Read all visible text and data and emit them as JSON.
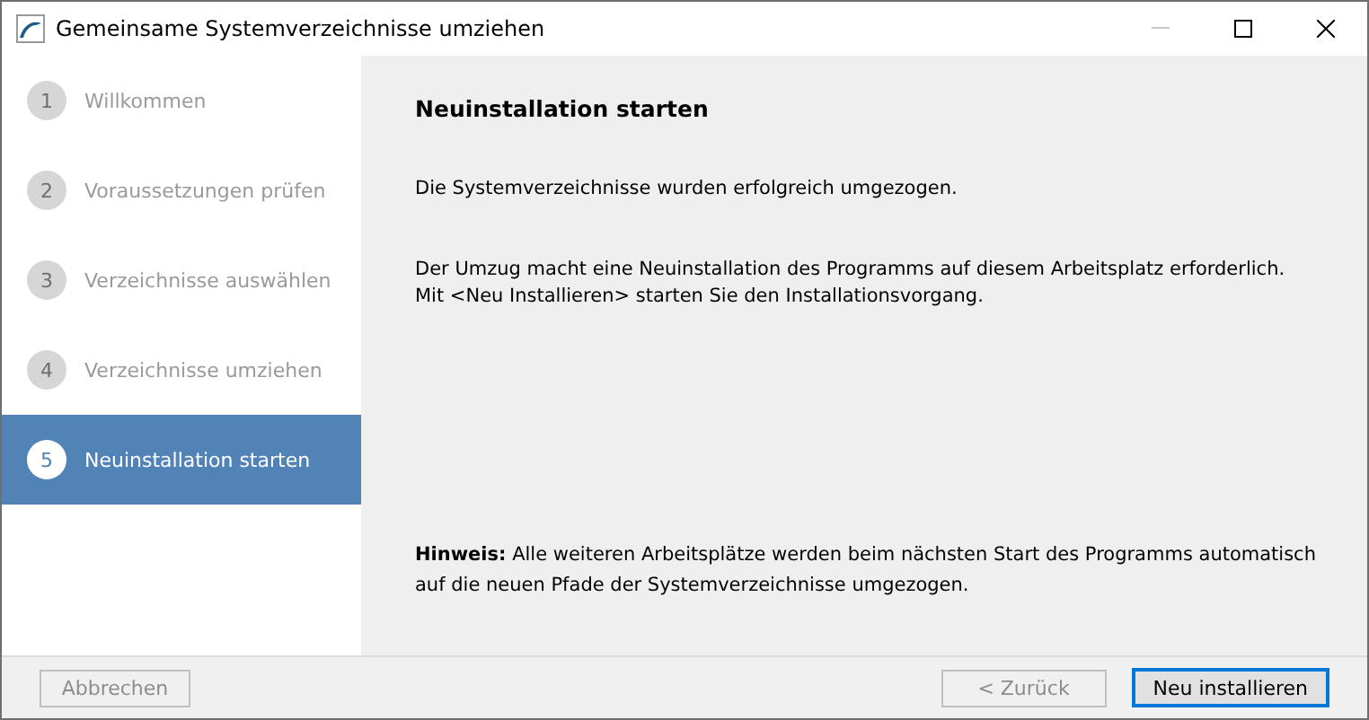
{
  "window": {
    "title": "Gemeinsame Systemverzeichnisse umziehen"
  },
  "steps": [
    {
      "number": "1",
      "label": "Willkommen",
      "selected": false
    },
    {
      "number": "2",
      "label": "Voraussetzungen prüfen",
      "selected": false
    },
    {
      "number": "3",
      "label": "Verzeichnisse auswählen",
      "selected": false
    },
    {
      "number": "4",
      "label": "Verzeichnisse umziehen",
      "selected": false
    },
    {
      "number": "5",
      "label": "Neuinstallation starten",
      "selected": true
    }
  ],
  "content": {
    "heading": "Neuinstallation starten",
    "paragraphs": [
      "Die Systemverzeichnisse wurden erfolgreich umgezogen.",
      "Der Umzug macht eine Neuinstallation des Programms auf diesem Arbeitsplatz erforderlich.\nMit <Neu Installieren> starten Sie den Installationsvorgang."
    ],
    "note": "**Hinweis:** Alle weiteren Arbeitsplätze werden beim nächsten Start des Programms automatisch auf die neuen Pfade der Systemverzeichnisse umgezogen."
  },
  "left_buttons": [
    {
      "label": "Abbrechen",
      "disabled": true,
      "default": false
    }
  ],
  "right_buttons": [
    {
      "label": "< Zurück",
      "disabled": true,
      "default": false
    },
    {
      "label": "Neu installieren",
      "disabled": false,
      "default": true
    }
  ]
}
